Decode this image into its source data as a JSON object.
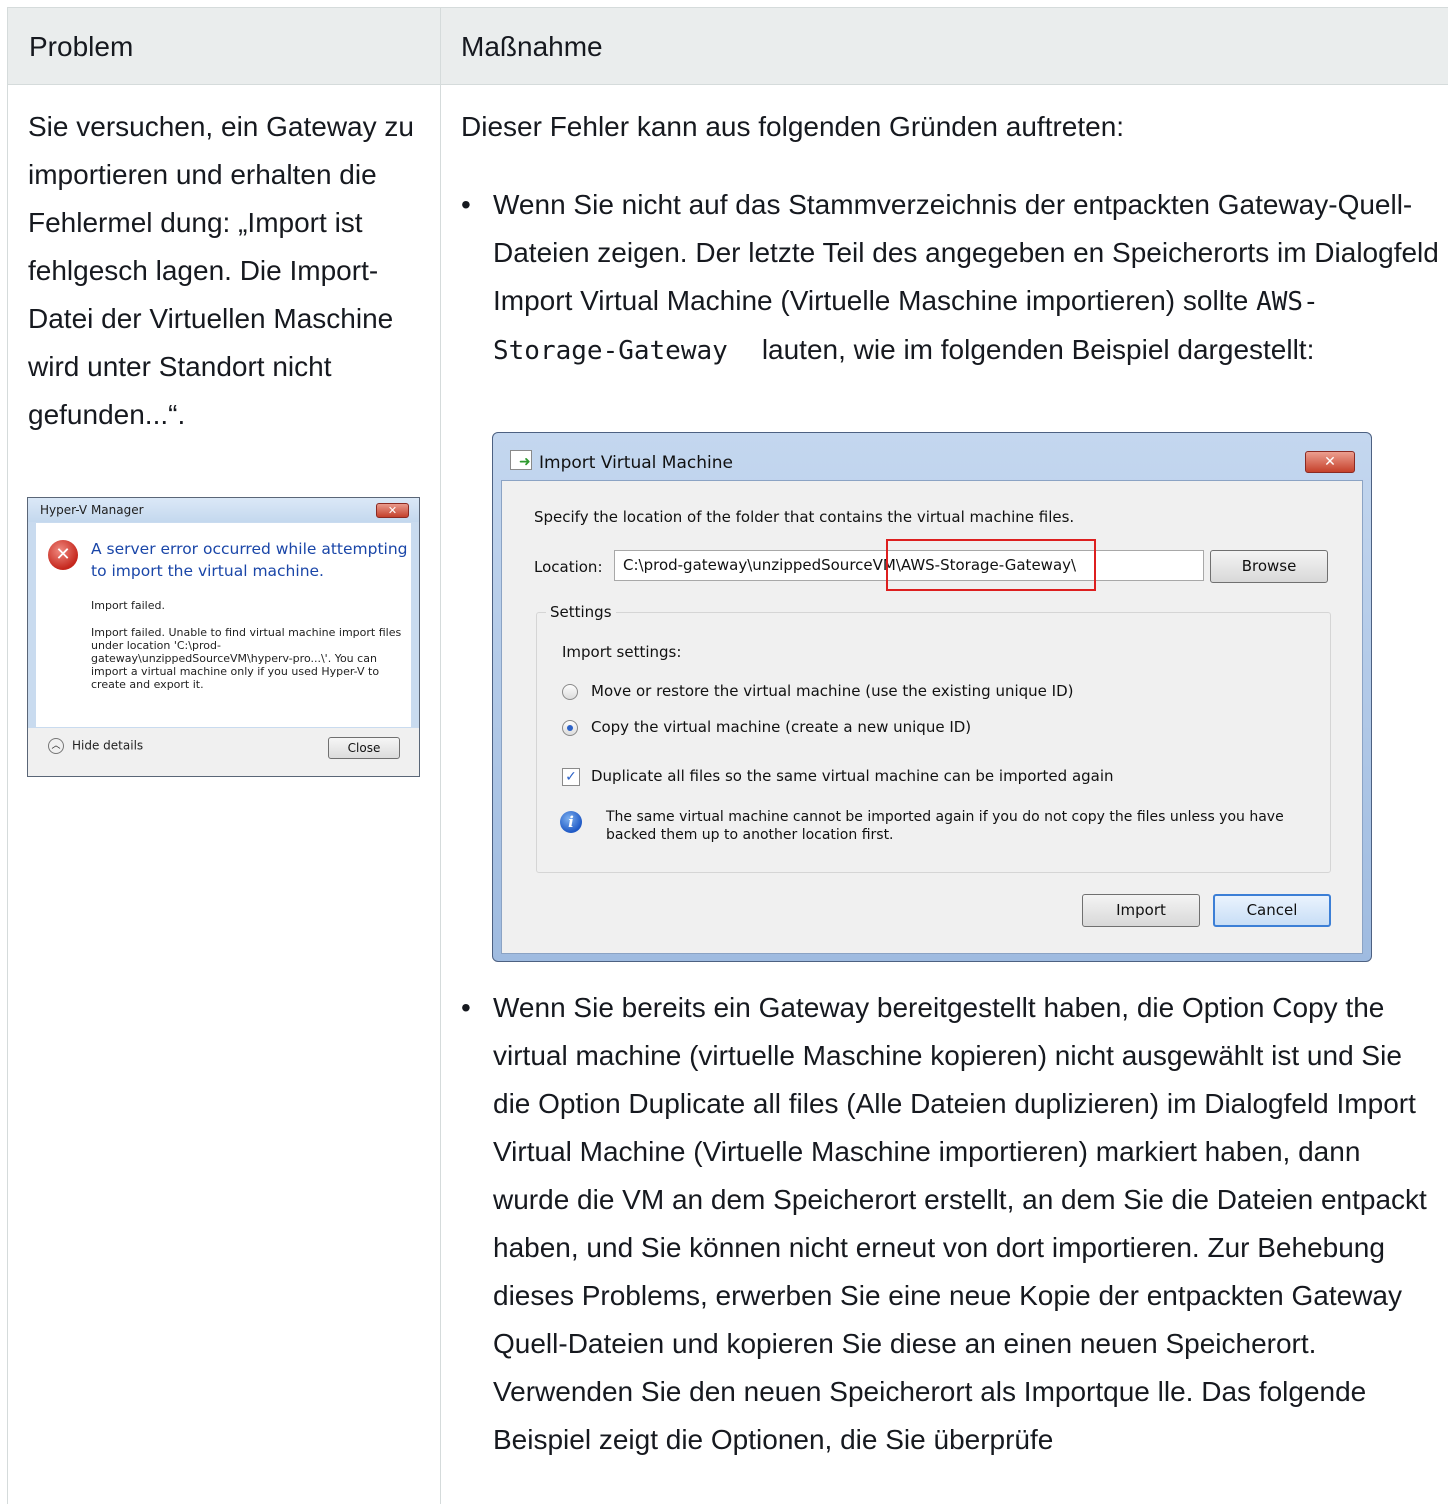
{
  "table": {
    "headers": [
      "Problem",
      "Maßnahme"
    ],
    "problem_text": "Sie versuchen, ein Gateway zu importieren und erhalten die Fehlermel dung: „Import ist fehlgesch lagen. Die Import-Datei der Virtuellen Maschine wird unter Standort nicht gefunden...“.",
    "intro_text": "Dieser Fehler kann aus folgenden Gründen auftreten:",
    "bullet_symbol": "•",
    "bullet1": {
      "before": "Wenn Sie nicht auf das Stammverzeichnis der entpackten Gateway-Quell-Dateien zeigen. Der letzte Teil des angegeben en Speicherorts im Dialogfeld Import Virtual Machine (Virtuelle Maschine importieren) sollte",
      "code": "AWS-Storage-Gateway",
      "after": "lauten, wie im folgenden Beispiel dargestellt:"
    },
    "bullet2": "Wenn Sie bereits ein Gateway bereitgestellt haben, die Option Copy the virtual machine (virtuelle Maschine kopieren) nicht ausgewählt ist und Sie die Option Duplicate all files (Alle Dateien duplizieren) im Dialogfeld Import Virtual Machine (Virtuelle Maschine importieren) markiert haben, dann wurde die VM an dem Speicherort erstellt, an dem Sie die Dateien entpackt haben, und Sie können nicht erneut von dort importieren. Zur Behebung dieses Problems, erwerben Sie eine neue Kopie der entpackten Gateway Quell-Dateien und kopieren Sie diese an einen neuen Speicherort. Verwenden Sie den neuen Speicherort als Importque lle. Das folgende Beispiel zeigt die Optionen, die Sie überprüfe"
  },
  "hyperv_dialog": {
    "title": "Hyper-V Manager",
    "close_glyph": "✕",
    "main_message": "A server error occurred while attempting to import the virtual machine.",
    "sub1": "Import failed.",
    "sub2": "Import failed. Unable to find virtual machine import files under location 'C:\\prod-gateway\\unzippedSourceVM\\hyperv-pro...\\'. You can import a virtual machine only if you used Hyper-V to create and export it.",
    "hide_details_label": "Hide details",
    "close_button": "Close",
    "error_icon": "error-icon"
  },
  "import_dialog": {
    "title": "Import Virtual Machine",
    "close_glyph": "✕",
    "instruction": "Specify the location of the folder that contains the virtual machine files.",
    "location_label": "Location:",
    "location_value": "C:\\prod-gateway\\unzippedSourceVM\\AWS-Storage-Gateway\\",
    "browse_button": "Browse",
    "settings_label": "Settings",
    "import_settings_label": "Import settings:",
    "option_move": "Move or restore the virtual machine (use the existing unique ID)",
    "option_copy": "Copy the virtual machine (create a new unique ID)",
    "selected_option": "copy",
    "duplicate_label": "Duplicate all files so the same virtual machine can be imported again",
    "duplicate_checked": true,
    "check_glyph": "✓",
    "info_glyph": "i",
    "info_text": "The same virtual machine cannot be imported again if you do not copy the files unless you have backed them up to another location first.",
    "import_button": "Import",
    "cancel_button": "Cancel",
    "highlight_color": "#dd1f1f"
  },
  "colors": {
    "header_bg": "#eaeded",
    "border": "#d5dbdb",
    "text": "#16191f",
    "hyperv_message": "#1a46a8"
  }
}
